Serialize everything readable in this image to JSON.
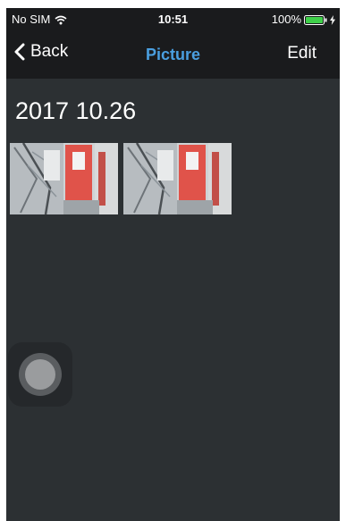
{
  "status_bar": {
    "carrier": "No SIM",
    "time": "10:51",
    "battery_percent": "100%",
    "battery_level": 1.0,
    "battery_color": "#3fd04a",
    "icons": [
      "wifi-icon",
      "battery-icon",
      "bolt-icon"
    ]
  },
  "navbar": {
    "back_label": "Back",
    "back_icon": "chevron-left-icon",
    "title": "Picture",
    "edit_label": "Edit",
    "title_color": "#4a9fe0"
  },
  "gallery": {
    "section_date": "2017 10.26",
    "photo_count": 2
  },
  "colors": {
    "background": "#2c3033",
    "header": "#1a1b1d"
  }
}
